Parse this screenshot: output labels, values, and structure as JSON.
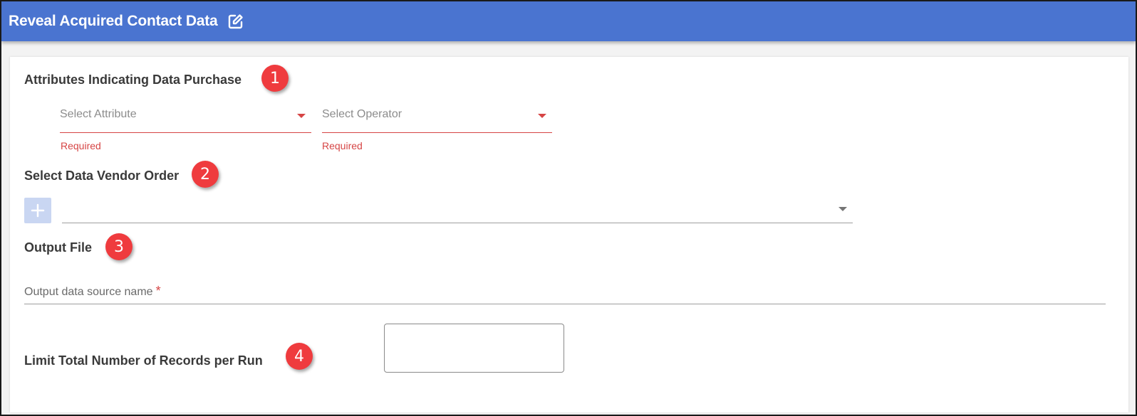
{
  "header": {
    "title": "Reveal Acquired Contact Data",
    "edit_icon": "edit-icon"
  },
  "colors": {
    "header_bg": "#4a74d0",
    "error": "#d64545",
    "badge": "#ef3b3e",
    "plus_button_bg": "#c9d6f2"
  },
  "sections": {
    "attributes": {
      "title": "Attributes Indicating Data Purchase",
      "badge": "1",
      "attribute_select": {
        "placeholder": "Select Attribute",
        "error": "Required"
      },
      "operator_select": {
        "placeholder": "Select Operator",
        "error": "Required"
      }
    },
    "vendor": {
      "title": "Select Data Vendor Order",
      "badge": "2",
      "add_icon": "plus-icon",
      "selected_value": ""
    },
    "output": {
      "title": "Output File",
      "badge": "3",
      "field_label": "Output data source name",
      "required_marker": "*",
      "value": ""
    },
    "limit": {
      "title": "Limit Total Number of Records per Run",
      "badge": "4",
      "value": ""
    }
  }
}
